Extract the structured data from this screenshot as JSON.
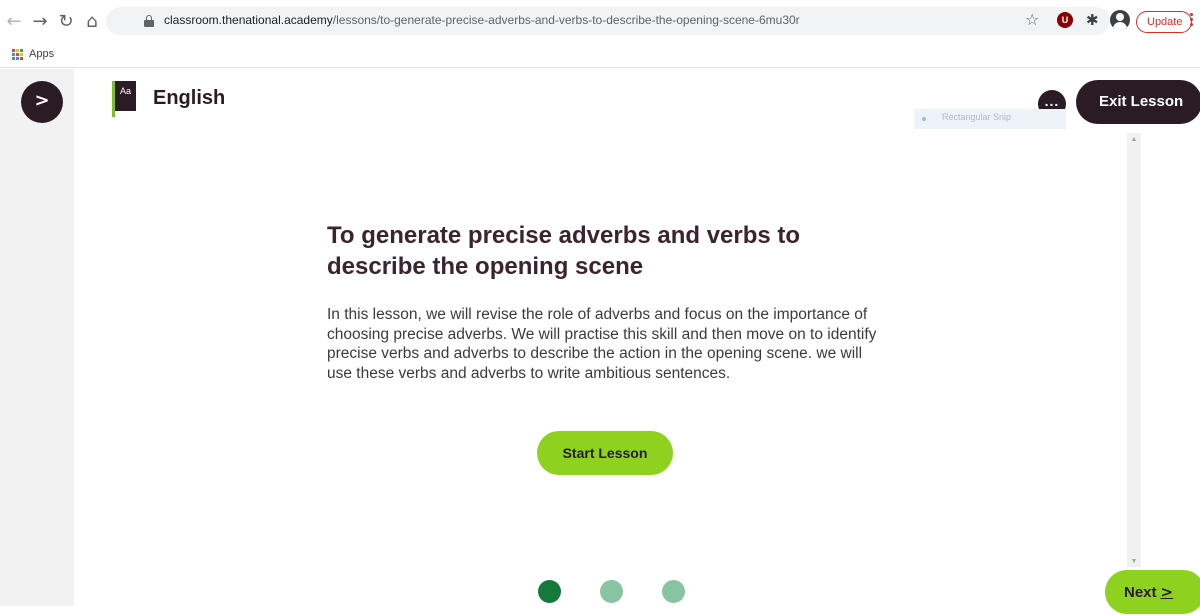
{
  "browser": {
    "url_host": "classroom.thenational.academy",
    "url_path": "/lessons/to-generate-precise-adverbs-and-verbs-to-describe-the-opening-scene-6mu30r",
    "update_label": "Update",
    "extension_badge": "U",
    "icons": {
      "back": "arrow-left-icon",
      "forward": "arrow-right-icon",
      "reload": "reload-icon",
      "home": "home-icon",
      "lock": "lock-icon",
      "bookmark": "star-icon",
      "extensions": "puzzle-icon",
      "profile": "profile-icon",
      "menu": "vertical-dots-icon"
    }
  },
  "bookmarks": {
    "apps_label": "Apps"
  },
  "header": {
    "subject_icon_text": "Aa",
    "subject": "English",
    "more_label": "...",
    "exit_label": "Exit Lesson",
    "menu_toggle_label": ">"
  },
  "snip_overlay": {
    "label": "Rectangular Snip"
  },
  "lesson": {
    "title": "To generate precise adverbs and verbs to describe the opening scene",
    "description": "In this lesson, we will revise the role of adverbs and focus on the importance of choosing precise adverbs. We will practise this skill and then move on to identify precise verbs and adverbs to describe the action in the opening scene. we will use these verbs and adverbs to write ambitious sentences.",
    "start_label": "Start Lesson"
  },
  "footer": {
    "next_label": "Next",
    "next_arrow": ">",
    "progress_total": 3,
    "progress_current": 1
  },
  "colors": {
    "brand_dark": "#2b1b24",
    "brand_green": "#8ed11f",
    "dot_active": "#137a3b",
    "dot_inactive": "#86c4a2"
  }
}
